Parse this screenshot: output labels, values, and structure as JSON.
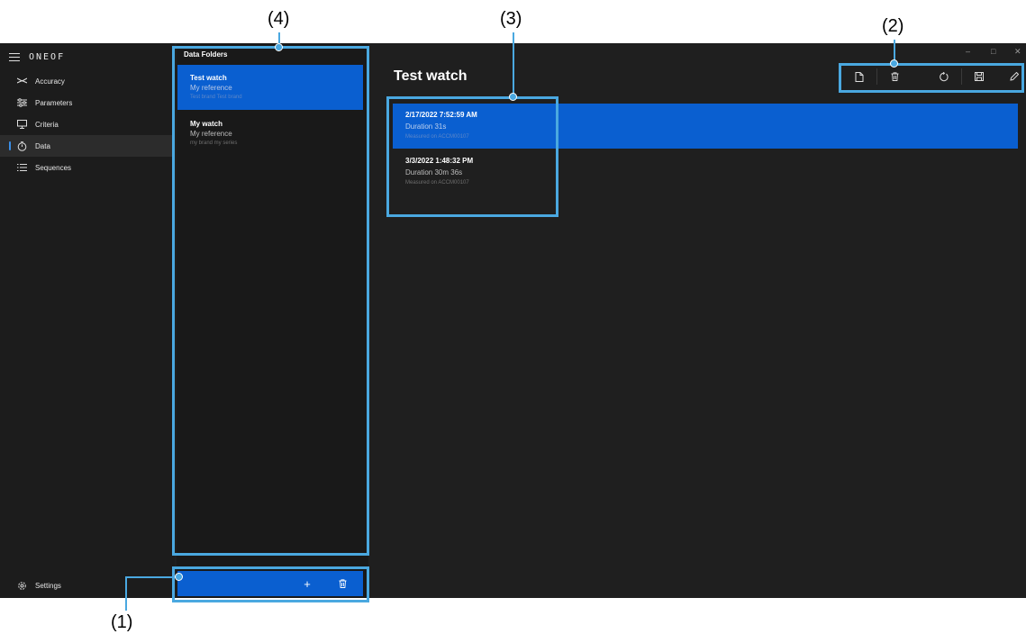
{
  "callouts": [
    "(1)",
    "(2)",
    "(3)",
    "(4)"
  ],
  "app": {
    "logo": "ONEOF",
    "window_controls": [
      "–",
      "□",
      "✕"
    ]
  },
  "sidebar": {
    "items": [
      {
        "label": "Accuracy",
        "icon": "accuracy-icon"
      },
      {
        "label": "Parameters",
        "icon": "sliders-icon"
      },
      {
        "label": "Criteria",
        "icon": "monitor-icon"
      },
      {
        "label": "Data",
        "icon": "stopwatch-icon",
        "active": true
      },
      {
        "label": "Sequences",
        "icon": "list-icon"
      }
    ],
    "settings_label": "Settings"
  },
  "folders": {
    "title": "Data Folders",
    "items": [
      {
        "name": "Test watch",
        "reference": "My reference",
        "brand": "Test brand Test brand",
        "selected": true
      },
      {
        "name": "My watch",
        "reference": "My reference",
        "brand": "my brand my series",
        "selected": false
      }
    ],
    "add_label": "+",
    "delete_label": "🗑"
  },
  "main": {
    "title": "Test watch",
    "toolbar": [
      "new-file-icon",
      "delete-icon",
      "refresh-icon",
      "save-icon",
      "edit-icon"
    ],
    "records": [
      {
        "date": "2/17/2022 7:52:59 AM",
        "duration": "Duration 31s",
        "measured": "Measured on ACCM00107",
        "selected": true
      },
      {
        "date": "3/3/2022 1:48:32 PM",
        "duration": "Duration 30m 36s",
        "measured": "Measured on ACCM00107",
        "selected": false
      }
    ]
  },
  "colors": {
    "accent": "#0a5fd0",
    "callout": "#4aa8e0",
    "background": "#1f1f1f"
  }
}
